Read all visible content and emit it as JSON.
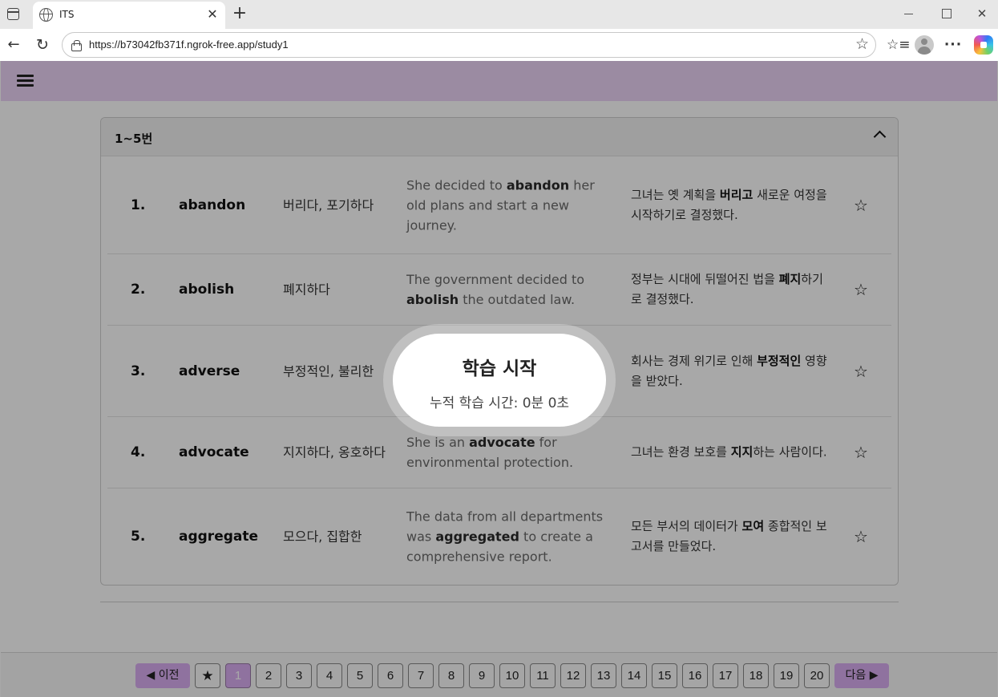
{
  "browser": {
    "tab_title": "ITS",
    "tab_close": "✕",
    "new_tab": "+",
    "url": "https://b73042fb371f.ngrok-free.app/study1",
    "back": "←",
    "reload": "↻",
    "favorite": "☆",
    "favorites_list": "☆≡",
    "more": "···",
    "win_close": "✕"
  },
  "card": {
    "title": "1~5번",
    "rows": [
      {
        "num": "1.",
        "word": "abandon",
        "meaning": "버리다, 포기하다",
        "ex_pre": "She decided to ",
        "ex_bold": "abandon",
        "ex_post": " her old plans and start a new journey.",
        "tr_pre": "그녀는 옛 계획을 ",
        "tr_bold": "버리고",
        "tr_post": " 새로운 여정을 시작하기로 결정했다."
      },
      {
        "num": "2.",
        "word": "abolish",
        "meaning": "폐지하다",
        "ex_pre": "The government decided to ",
        "ex_bold": "abolish",
        "ex_post": " the outdated law.",
        "tr_pre": "정부는 시대에 뒤떨어진 법을 ",
        "tr_bold": "폐지",
        "tr_post": "하기로 결정했다."
      },
      {
        "num": "3.",
        "word": "adverse",
        "meaning": "부정적인, 불리한",
        "ex_pre": "",
        "ex_bold": "",
        "ex_post": "",
        "tr_pre": "회사는 경제 위기로 인해 ",
        "tr_bold": "부정적인",
        "tr_post": " 영향을 받았다."
      },
      {
        "num": "4.",
        "word": "advocate",
        "meaning": "지지하다, 옹호하다",
        "ex_pre": "She is an ",
        "ex_bold": "advocate",
        "ex_post": " for environmental protection.",
        "tr_pre": "그녀는 환경 보호를 ",
        "tr_bold": "지지",
        "tr_post": "하는 사람이다."
      },
      {
        "num": "5.",
        "word": "aggregate",
        "meaning": "모으다, 집합한",
        "ex_pre": "The data from all departments was ",
        "ex_bold": "aggregated",
        "ex_post": " to create a comprehensive report.",
        "tr_pre": "모든 부서의 데이터가 ",
        "tr_bold": "모여",
        "tr_post": " 종합적인 보고서를 만들었다."
      }
    ]
  },
  "pager": {
    "prev": "◀ 이전",
    "next": "다음 ▶",
    "star": "★",
    "pages": [
      "1",
      "2",
      "3",
      "4",
      "5",
      "6",
      "7",
      "8",
      "9",
      "10",
      "11",
      "12",
      "13",
      "14",
      "15",
      "16",
      "17",
      "18",
      "19",
      "20"
    ],
    "current": "1"
  },
  "modal": {
    "title": "학습 시작",
    "subtitle": "누적 학습 시간: 0분 0초"
  },
  "colors": {
    "header_bg": "#ebd3f6",
    "accent": "#d9aef2"
  }
}
